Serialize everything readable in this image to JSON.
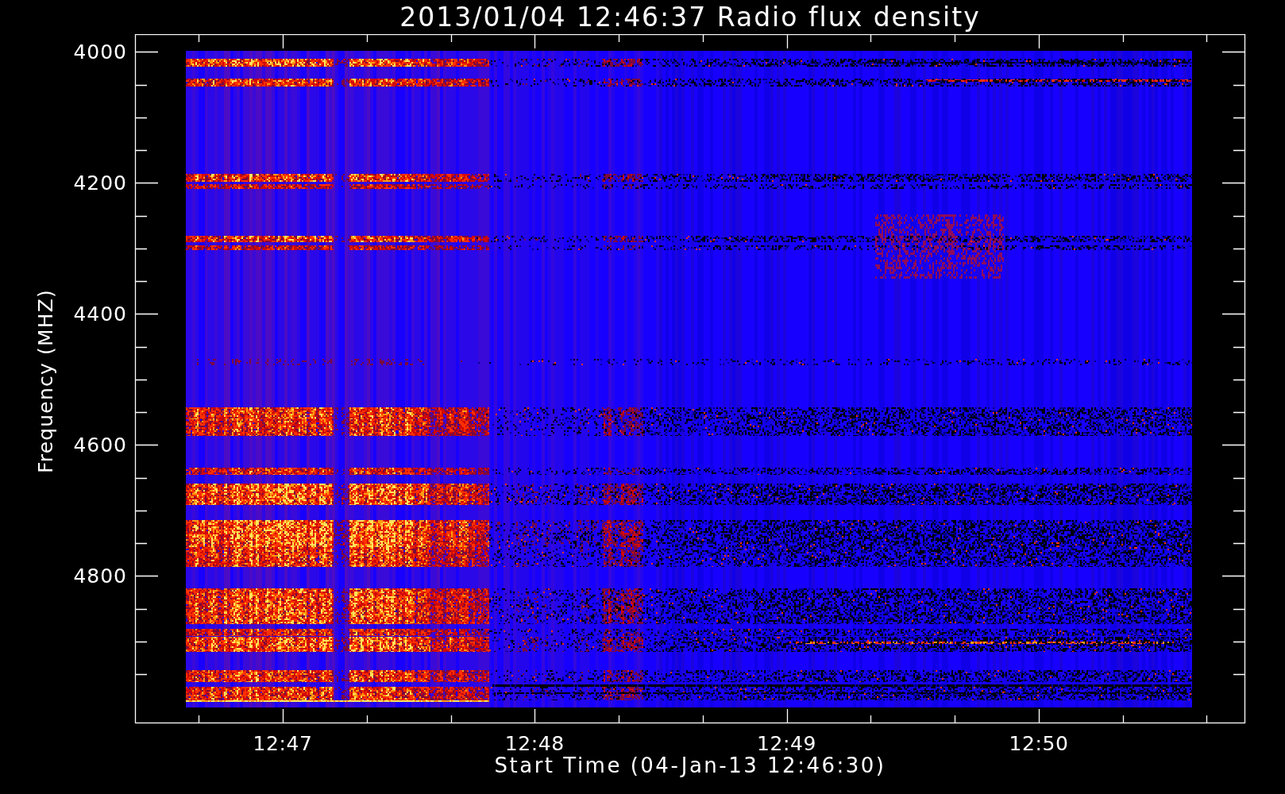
{
  "plot": {
    "title": "2013/01/04 12:46:37 Radio flux density",
    "ylabel": "Frequency (MHZ)",
    "yticks": [
      "4000",
      "4200",
      "4400",
      "4600",
      "4800"
    ],
    "xticks": [
      "12:47",
      "12:48",
      "12:49",
      "12:50"
    ],
    "xlabel": "Start Time (04-Jan-13 12:46:30)"
  }
}
